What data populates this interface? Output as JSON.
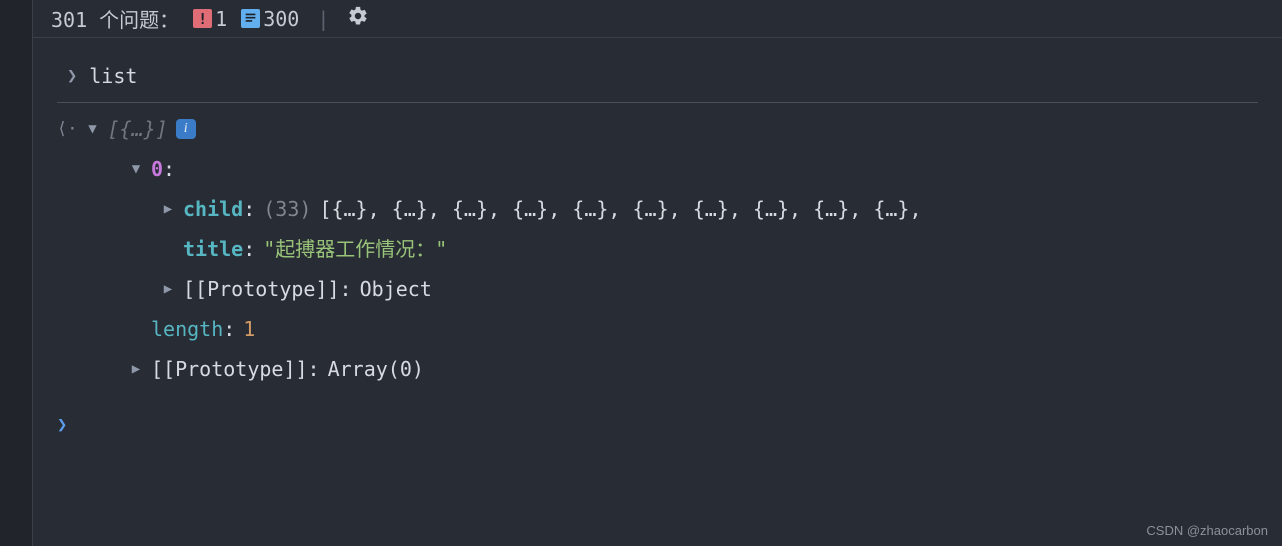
{
  "header": {
    "issues_label": "301 个问题：",
    "warn_count": "1",
    "info_count": "300",
    "divider": "|"
  },
  "console": {
    "expr_label": "list",
    "result_summary": "[{…}]",
    "info_badge": "i",
    "index0": {
      "label": "0",
      "child": {
        "key": "child",
        "count": "(33)",
        "preview": "[{…}, {…}, {…}, {…}, {…}, {…}, {…}, {…}, {…}, {…},"
      },
      "title": {
        "key": "title",
        "value": "\"起搏器工作情况：\""
      },
      "proto_obj": {
        "key": "[[Prototype]]",
        "value": "Object"
      }
    },
    "length": {
      "key": "length",
      "value": "1"
    },
    "proto_arr": {
      "key": "[[Prototype]]",
      "value": "Array(0)"
    }
  },
  "watermark": "CSDN @zhaocarbon"
}
